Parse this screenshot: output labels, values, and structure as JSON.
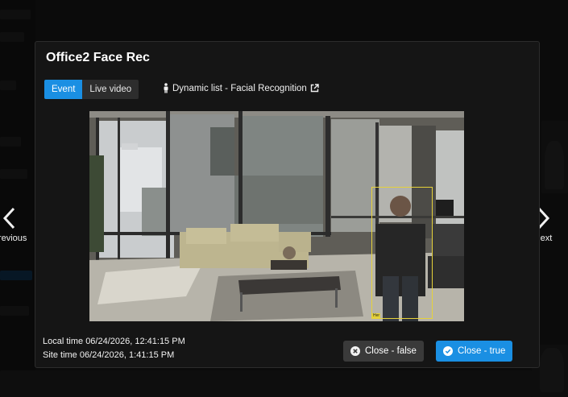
{
  "modal": {
    "title": "Office2 Face Rec",
    "tabs": [
      {
        "label": "Event",
        "active": true
      },
      {
        "label": "Live video",
        "active": false
      }
    ],
    "dynamic_link": {
      "label": "Dynamic list - Facial Recognition",
      "icon": "external-link-icon"
    },
    "local_time": "Local time 06/24/2026, 12:41:15 PM",
    "site_time": "Site time 06/24/2026, 1:41:15 PM",
    "close_false_label": "Close - false",
    "close_true_label": "Close - true",
    "detection_tag": "Her"
  },
  "nav": {
    "previous_label": "Previous",
    "next_label": "Next"
  },
  "colors": {
    "accent": "#1a8fe3",
    "bbox": "#e6d23a",
    "modal_bg": "#151515"
  }
}
